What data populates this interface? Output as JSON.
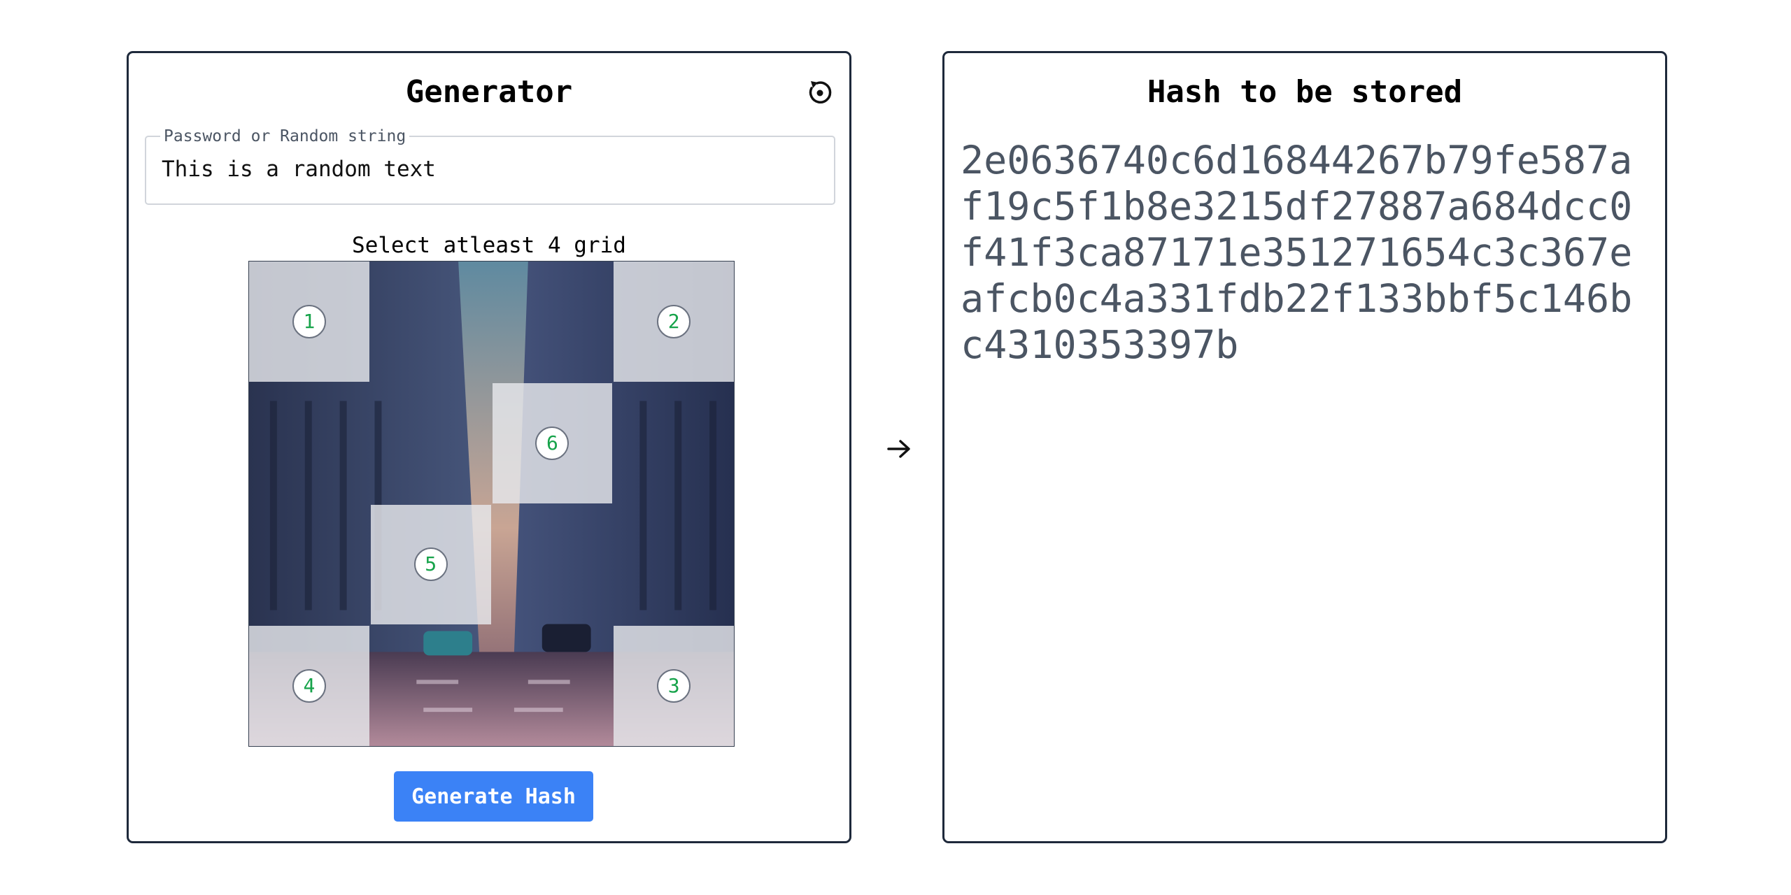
{
  "generator": {
    "title": "Generator",
    "reset_icon": "reset-icon",
    "field_label": "Password or Random string",
    "field_value": "This is a random text",
    "grid_caption": "Select atleast 4 grid",
    "cells": [
      {
        "label": "1",
        "selected": true
      },
      {
        "label": "",
        "selected": false
      },
      {
        "label": "",
        "selected": false
      },
      {
        "label": "2",
        "selected": true
      },
      {
        "label": "",
        "selected": false
      },
      {
        "label": "",
        "selected": false
      },
      {
        "label": "6",
        "selected": true
      },
      {
        "label": "",
        "selected": false
      },
      {
        "label": "",
        "selected": false
      },
      {
        "label": "5",
        "selected": true
      },
      {
        "label": "",
        "selected": false
      },
      {
        "label": "",
        "selected": false
      },
      {
        "label": "4",
        "selected": true
      },
      {
        "label": "",
        "selected": false
      },
      {
        "label": "",
        "selected": false
      },
      {
        "label": "3",
        "selected": true
      }
    ],
    "button_label": "Generate Hash",
    "accent_color": "#3b82f6",
    "badge_color": "#16a34a"
  },
  "arrow_icon": "arrow-right-icon",
  "hash_panel": {
    "title": "Hash to be stored",
    "hash_value": "2e0636740c6d16844267b79fe587af19c5f1b8e3215df27887a684dcc0f41f3ca87171e351271654c3c367eafcb0c4a331fdb22f133bbf5c146bc4310353397b"
  }
}
